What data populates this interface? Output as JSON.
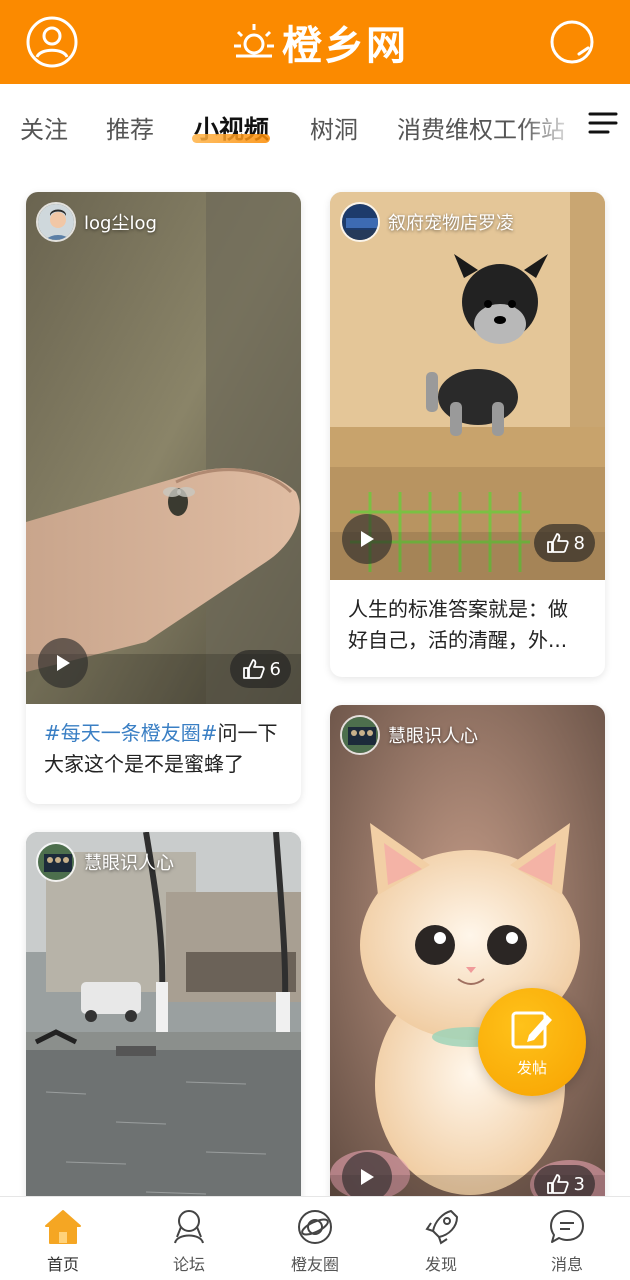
{
  "header": {
    "logo_text": "橙乡网",
    "colors": {
      "brand": "#fb8a00",
      "accent_gold": "#f7a200"
    },
    "left_icon": "user-circle-icon",
    "right_icon": "search-icon"
  },
  "tabs": {
    "items": [
      {
        "label": "关注",
        "active": false
      },
      {
        "label": "推荐",
        "active": false
      },
      {
        "label": "小视频",
        "active": true
      },
      {
        "label": "树洞",
        "active": false
      },
      {
        "label": "消费维权工作站",
        "active": false
      }
    ],
    "menu_icon": "menu-lines-icon"
  },
  "feed": {
    "cards": [
      {
        "author": "log尘log",
        "likes": "6",
        "hashtag": "#每天一条橙友圈#",
        "caption": "问一下大家这个是不是蜜蜂了",
        "thumbnail": "hand-with-insect"
      },
      {
        "author": "叙府宠物店罗凌",
        "likes": "8",
        "caption": "人生的标准答案就是：做好自己，活的清醒，外...",
        "thumbnail": "schnauzer-puppy"
      },
      {
        "author": "慧眼识人心",
        "likes": "3",
        "thumbnail": "kitten-cartoon"
      },
      {
        "author": "慧眼识人心",
        "thumbnail": "rainy-street"
      }
    ]
  },
  "fab": {
    "label": "发帖",
    "icon": "edit-icon"
  },
  "bottom_nav": {
    "items": [
      {
        "label": "首页",
        "icon": "home-icon",
        "active": true
      },
      {
        "label": "论坛",
        "icon": "forum-icon",
        "active": false
      },
      {
        "label": "橙友圈",
        "icon": "planet-icon",
        "active": false
      },
      {
        "label": "发现",
        "icon": "rocket-icon",
        "active": false
      },
      {
        "label": "消息",
        "icon": "message-icon",
        "active": false
      }
    ]
  }
}
